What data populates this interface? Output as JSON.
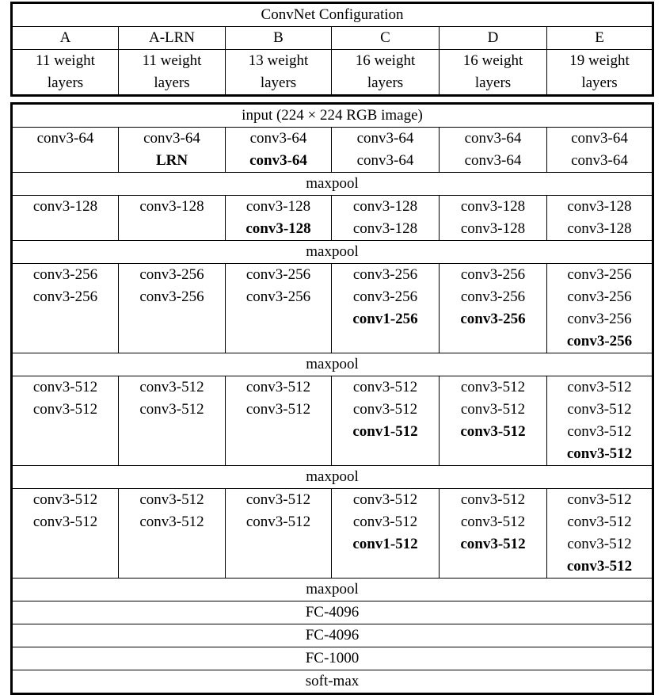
{
  "table": {
    "title": "ConvNet Configuration",
    "columns": [
      {
        "name": "A",
        "depth": "11 weight\nlayers"
      },
      {
        "name": "A-LRN",
        "depth": "11 weight\nlayers"
      },
      {
        "name": "B",
        "depth": "13 weight\nlayers"
      },
      {
        "name": "C",
        "depth": "16 weight\nlayers"
      },
      {
        "name": "D",
        "depth": "16 weight\nlayers"
      },
      {
        "name": "E",
        "depth": "19 weight\nlayers"
      }
    ],
    "depth_line1": [
      "11 weight",
      "11 weight",
      "13 weight",
      "16 weight",
      "16 weight",
      "19 weight"
    ],
    "depth_line2": [
      "layers",
      "layers",
      "layers",
      "layers",
      "layers",
      "layers"
    ],
    "input_row": "input (224 × 224 RGB image)",
    "maxpool": "maxpool",
    "blocks": [
      {
        "id": "conv64",
        "rows": 2,
        "cells": [
          {
            "lines": [
              {
                "text": "conv3-64",
                "bold": false
              }
            ]
          },
          {
            "lines": [
              {
                "text": "conv3-64",
                "bold": false
              },
              {
                "text": "LRN",
                "bold": true
              }
            ]
          },
          {
            "lines": [
              {
                "text": "conv3-64",
                "bold": false
              },
              {
                "text": "conv3-64",
                "bold": true
              }
            ]
          },
          {
            "lines": [
              {
                "text": "conv3-64",
                "bold": false
              },
              {
                "text": "conv3-64",
                "bold": false
              }
            ]
          },
          {
            "lines": [
              {
                "text": "conv3-64",
                "bold": false
              },
              {
                "text": "conv3-64",
                "bold": false
              }
            ]
          },
          {
            "lines": [
              {
                "text": "conv3-64",
                "bold": false
              },
              {
                "text": "conv3-64",
                "bold": false
              }
            ]
          }
        ]
      },
      {
        "id": "conv128",
        "rows": 2,
        "cells": [
          {
            "lines": [
              {
                "text": "conv3-128",
                "bold": false
              }
            ]
          },
          {
            "lines": [
              {
                "text": "conv3-128",
                "bold": false
              }
            ]
          },
          {
            "lines": [
              {
                "text": "conv3-128",
                "bold": false
              },
              {
                "text": "conv3-128",
                "bold": true
              }
            ]
          },
          {
            "lines": [
              {
                "text": "conv3-128",
                "bold": false
              },
              {
                "text": "conv3-128",
                "bold": false
              }
            ]
          },
          {
            "lines": [
              {
                "text": "conv3-128",
                "bold": false
              },
              {
                "text": "conv3-128",
                "bold": false
              }
            ]
          },
          {
            "lines": [
              {
                "text": "conv3-128",
                "bold": false
              },
              {
                "text": "conv3-128",
                "bold": false
              }
            ]
          }
        ]
      },
      {
        "id": "conv256",
        "rows": 4,
        "cells": [
          {
            "lines": [
              {
                "text": "conv3-256",
                "bold": false
              },
              {
                "text": "conv3-256",
                "bold": false
              }
            ]
          },
          {
            "lines": [
              {
                "text": "conv3-256",
                "bold": false
              },
              {
                "text": "conv3-256",
                "bold": false
              }
            ]
          },
          {
            "lines": [
              {
                "text": "conv3-256",
                "bold": false
              },
              {
                "text": "conv3-256",
                "bold": false
              }
            ]
          },
          {
            "lines": [
              {
                "text": "conv3-256",
                "bold": false
              },
              {
                "text": "conv3-256",
                "bold": false
              },
              {
                "text": "conv1-256",
                "bold": true
              }
            ]
          },
          {
            "lines": [
              {
                "text": "conv3-256",
                "bold": false
              },
              {
                "text": "conv3-256",
                "bold": false
              },
              {
                "text": "conv3-256",
                "bold": true
              }
            ]
          },
          {
            "lines": [
              {
                "text": "conv3-256",
                "bold": false
              },
              {
                "text": "conv3-256",
                "bold": false
              },
              {
                "text": "conv3-256",
                "bold": false
              },
              {
                "text": "conv3-256",
                "bold": true
              }
            ]
          }
        ]
      },
      {
        "id": "conv512a",
        "rows": 4,
        "cells": [
          {
            "lines": [
              {
                "text": "conv3-512",
                "bold": false
              },
              {
                "text": "conv3-512",
                "bold": false
              }
            ]
          },
          {
            "lines": [
              {
                "text": "conv3-512",
                "bold": false
              },
              {
                "text": "conv3-512",
                "bold": false
              }
            ]
          },
          {
            "lines": [
              {
                "text": "conv3-512",
                "bold": false
              },
              {
                "text": "conv3-512",
                "bold": false
              }
            ]
          },
          {
            "lines": [
              {
                "text": "conv3-512",
                "bold": false
              },
              {
                "text": "conv3-512",
                "bold": false
              },
              {
                "text": "conv1-512",
                "bold": true
              }
            ]
          },
          {
            "lines": [
              {
                "text": "conv3-512",
                "bold": false
              },
              {
                "text": "conv3-512",
                "bold": false
              },
              {
                "text": "conv3-512",
                "bold": true
              }
            ]
          },
          {
            "lines": [
              {
                "text": "conv3-512",
                "bold": false
              },
              {
                "text": "conv3-512",
                "bold": false
              },
              {
                "text": "conv3-512",
                "bold": false
              },
              {
                "text": "conv3-512",
                "bold": true
              }
            ]
          }
        ]
      },
      {
        "id": "conv512b",
        "rows": 4,
        "cells": [
          {
            "lines": [
              {
                "text": "conv3-512",
                "bold": false
              },
              {
                "text": "conv3-512",
                "bold": false
              }
            ]
          },
          {
            "lines": [
              {
                "text": "conv3-512",
                "bold": false
              },
              {
                "text": "conv3-512",
                "bold": false
              }
            ]
          },
          {
            "lines": [
              {
                "text": "conv3-512",
                "bold": false
              },
              {
                "text": "conv3-512",
                "bold": false
              }
            ]
          },
          {
            "lines": [
              {
                "text": "conv3-512",
                "bold": false
              },
              {
                "text": "conv3-512",
                "bold": false
              },
              {
                "text": "conv1-512",
                "bold": true
              }
            ]
          },
          {
            "lines": [
              {
                "text": "conv3-512",
                "bold": false
              },
              {
                "text": "conv3-512",
                "bold": false
              },
              {
                "text": "conv3-512",
                "bold": true
              }
            ]
          },
          {
            "lines": [
              {
                "text": "conv3-512",
                "bold": false
              },
              {
                "text": "conv3-512",
                "bold": false
              },
              {
                "text": "conv3-512",
                "bold": false
              },
              {
                "text": "conv3-512",
                "bold": true
              }
            ]
          }
        ]
      }
    ],
    "footer_rows": [
      "maxpool",
      "FC-4096",
      "FC-4096",
      "FC-1000",
      "soft-max"
    ]
  }
}
